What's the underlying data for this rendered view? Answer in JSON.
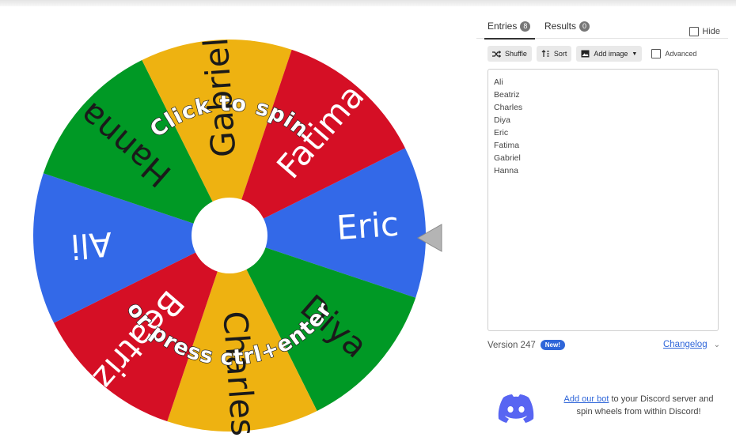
{
  "wheel": {
    "slices": [
      {
        "label": "Eric",
        "color": "#3369e8",
        "text_color": "light"
      },
      {
        "label": "Diya",
        "color": "#009925",
        "text_color": "dark"
      },
      {
        "label": "Charles",
        "color": "#eeb211",
        "text_color": "dark"
      },
      {
        "label": "Beatriz",
        "color": "#d50f25",
        "text_color": "light"
      },
      {
        "label": "Ali",
        "color": "#3369e8",
        "text_color": "light"
      },
      {
        "label": "Hanna",
        "color": "#009925",
        "text_color": "dark"
      },
      {
        "label": "Gabriel",
        "color": "#eeb211",
        "text_color": "dark"
      },
      {
        "label": "Fatima",
        "color": "#d50f25",
        "text_color": "light"
      }
    ],
    "hint_top": "Click to spin",
    "hint_bottom": "or press ctrl+enter"
  },
  "tabs": {
    "entries_label": "Entries",
    "entries_count": "8",
    "results_label": "Results",
    "results_count": "0",
    "hide_label": "Hide"
  },
  "toolbar": {
    "shuffle_label": "Shuffle",
    "sort_label": "Sort",
    "add_image_label": "Add image",
    "advanced_label": "Advanced"
  },
  "entries": [
    "Ali",
    "Beatriz",
    "Charles",
    "Diya",
    "Eric",
    "Fatima",
    "Gabriel",
    "Hanna"
  ],
  "footer": {
    "version_label": "Version 247",
    "new_badge": "New!",
    "changelog_label": "Changelog"
  },
  "discord": {
    "link_text": "Add our bot",
    "rest_text": " to your Discord server and spin wheels from within Discord!"
  },
  "colors": {
    "accent": "#2f66d9",
    "discord": "#5865f2"
  }
}
